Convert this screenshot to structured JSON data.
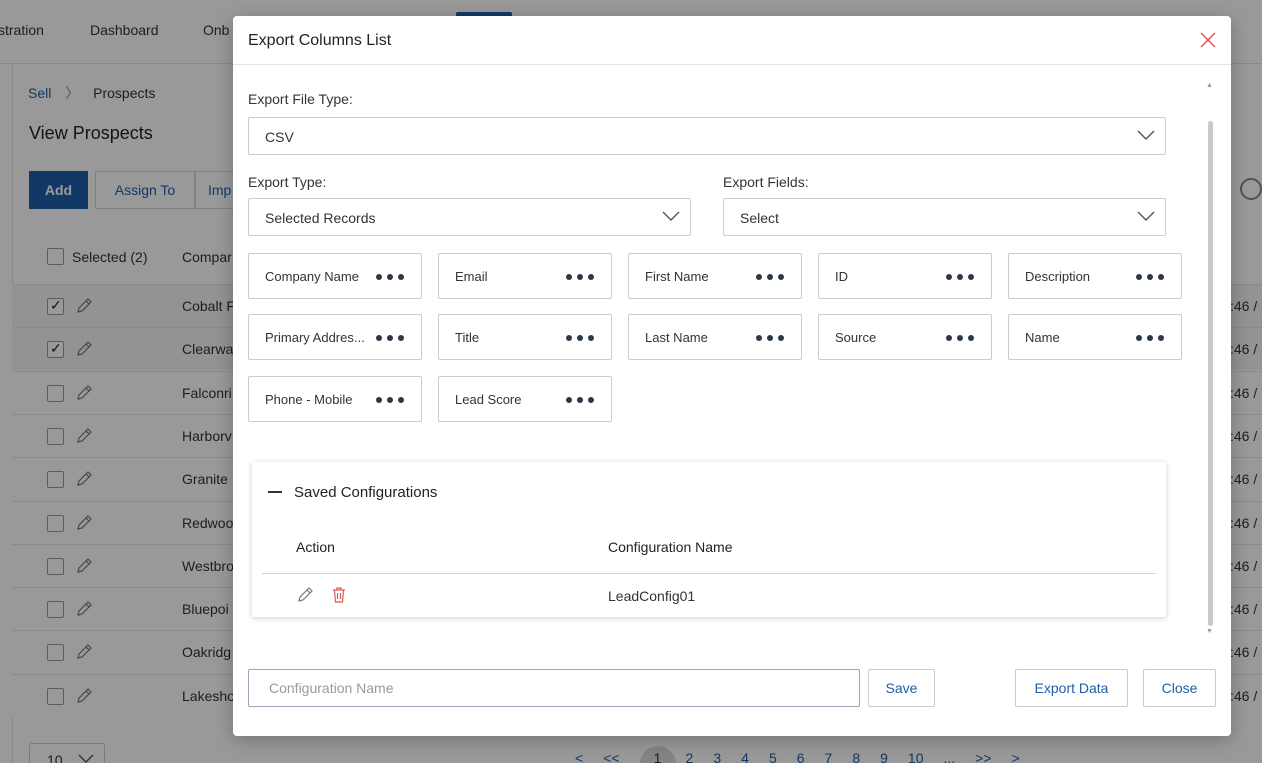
{
  "nav": {
    "items": [
      "stration",
      "Dashboard",
      "Onb"
    ]
  },
  "breadcrumb": {
    "root": "Sell",
    "current": "Prospects"
  },
  "page": {
    "title": "View Prospects",
    "add_label": "Add",
    "assign_label": "Assign To",
    "import_label": "Imp"
  },
  "table": {
    "selected_label": "Selected (2)",
    "company_header": "Compar",
    "rows": [
      {
        "company": "Cobalt F",
        "time": ":46 /",
        "checked": true
      },
      {
        "company": "Clearwa",
        "time": ":46 /",
        "checked": true
      },
      {
        "company": "Falconri",
        "time": ":46 /",
        "checked": false
      },
      {
        "company": "Harborv",
        "time": ":46 /",
        "checked": false
      },
      {
        "company": "Granite",
        "time": ":46 /",
        "checked": false
      },
      {
        "company": "Redwoo",
        "time": ":46 /",
        "checked": false
      },
      {
        "company": "Westbro",
        "time": ":46 /",
        "checked": false
      },
      {
        "company": "Bluepoi",
        "time": ":46 /",
        "checked": false
      },
      {
        "company": "Oakridg",
        "time": ":46 /",
        "checked": false
      },
      {
        "company": "Lakesho",
        "time": ":46 /",
        "checked": false
      }
    ]
  },
  "pager": {
    "page_size": "10",
    "items": [
      "<",
      "<<",
      "1",
      "2",
      "3",
      "4",
      "5",
      "6",
      "7",
      "8",
      "9",
      "10",
      "...",
      ">>",
      ">"
    ],
    "current": "1"
  },
  "modal": {
    "title": "Export Columns List",
    "file_type_label": "Export File Type:",
    "file_type_value": "CSV",
    "export_type_label": "Export Type:",
    "export_type_value": "Selected Records",
    "export_fields_label": "Export Fields:",
    "export_fields_value": "Select",
    "chips": [
      "Company Name",
      "Email",
      "First Name",
      "ID",
      "Description",
      "Primary Addres...",
      "Title",
      "Last Name",
      "Source",
      "Name",
      "Phone - Mobile",
      "Lead Score"
    ],
    "saved": {
      "title": "Saved Configurations",
      "col_action": "Action",
      "col_name": "Configuration Name",
      "rows": [
        {
          "name": "LeadConfig01"
        }
      ]
    },
    "config_placeholder": "Configuration Name",
    "config_value": "",
    "save_label": "Save",
    "export_label": "Export Data",
    "close_label": "Close"
  },
  "colors": {
    "accent": "#1e5fa8",
    "danger": "#e05555",
    "overlay": "rgba(0,0,0,0.4)"
  }
}
